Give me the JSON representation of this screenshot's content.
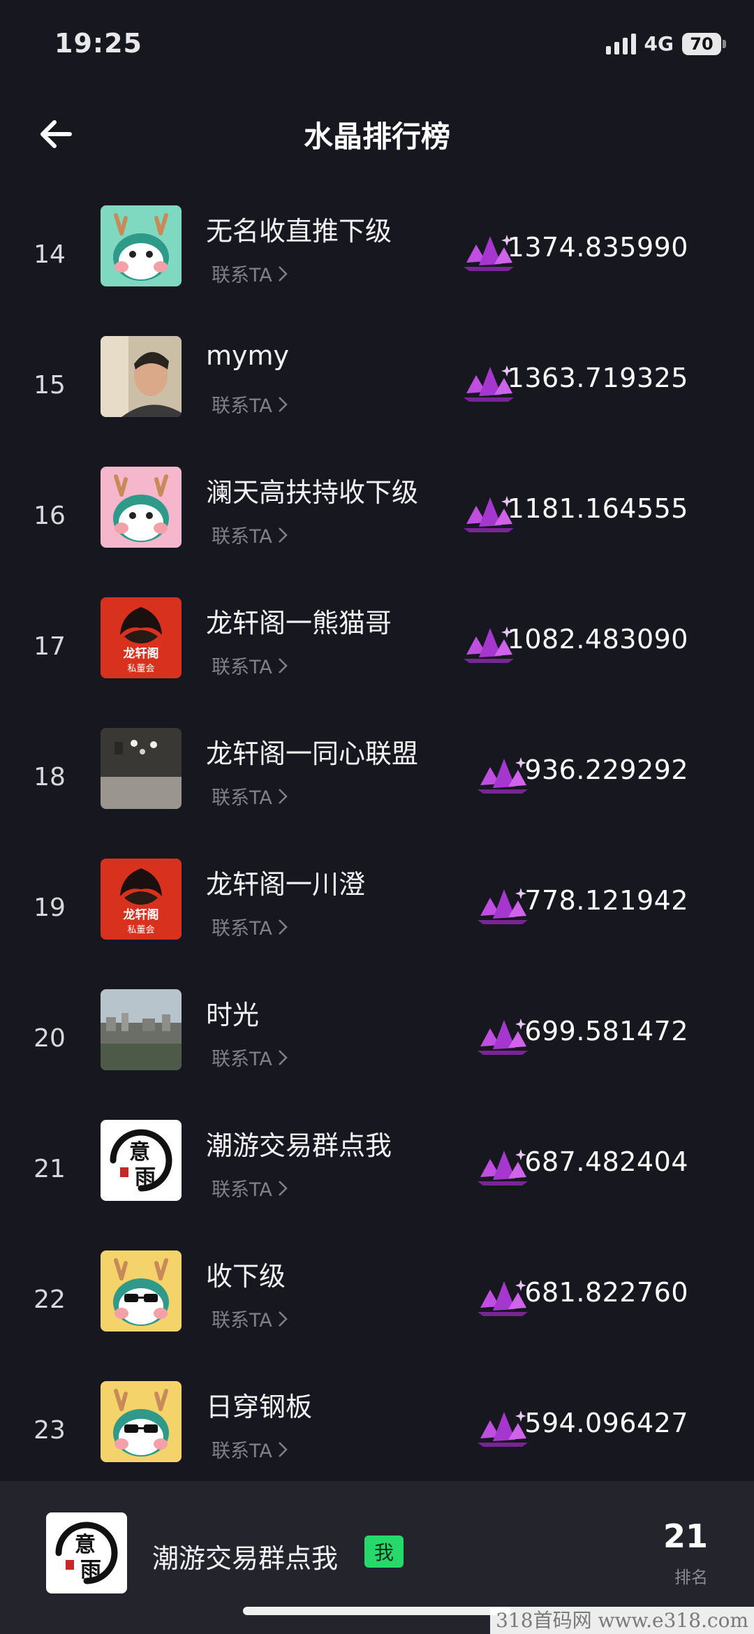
{
  "status_bar": {
    "time": "19:25",
    "network": "4G",
    "battery": "70"
  },
  "header": {
    "title": "水晶排行榜"
  },
  "contact_label": "联系TA",
  "rows": [
    {
      "rank": "14",
      "name": "无名收直推下级",
      "value": "1374.835990",
      "avatar": "dragon-mint-icon"
    },
    {
      "rank": "15",
      "name": "mymy",
      "value": "1363.719325",
      "avatar": "person-photo"
    },
    {
      "rank": "16",
      "name": "澜天高扶持收下级",
      "value": "1181.164555",
      "avatar": "dragon-pink-icon"
    },
    {
      "rank": "17",
      "name": "龙轩阁一熊猫哥",
      "value": "1082.483090",
      "avatar": "longxuange-logo"
    },
    {
      "rank": "18",
      "name": "龙轩阁一同心联盟",
      "value": "936.229292",
      "avatar": "dark-photo"
    },
    {
      "rank": "19",
      "name": "龙轩阁一川澄",
      "value": "778.121942",
      "avatar": "longxuange-logo"
    },
    {
      "rank": "20",
      "name": "时光",
      "value": "699.581472",
      "avatar": "city-photo"
    },
    {
      "rank": "21",
      "name": "潮游交易群点我",
      "value": "687.482404",
      "avatar": "yiyu-logo"
    },
    {
      "rank": "22",
      "name": "收下级",
      "value": "681.822760",
      "avatar": "dragon-sunglasses-icon"
    },
    {
      "rank": "23",
      "name": "日穿钢板",
      "value": "594.096427",
      "avatar": "dragon-sunglasses-icon"
    }
  ],
  "logos": {
    "longxuange": "龙轩阁",
    "longxuange_sub": "私董会",
    "yiyu_1": "意",
    "yiyu_2": "雨"
  },
  "me": {
    "name": "潮游交易群点我",
    "badge": "我",
    "rank": "21",
    "rank_label": "排名",
    "avatar": "yiyu-logo"
  },
  "watermark": "318首码网 www.e318.com",
  "colors": {
    "background": "#17171f",
    "bar": "#24242c",
    "badge": "#27d96b",
    "crystal": "#b03fd6",
    "muted": "#80808a"
  }
}
